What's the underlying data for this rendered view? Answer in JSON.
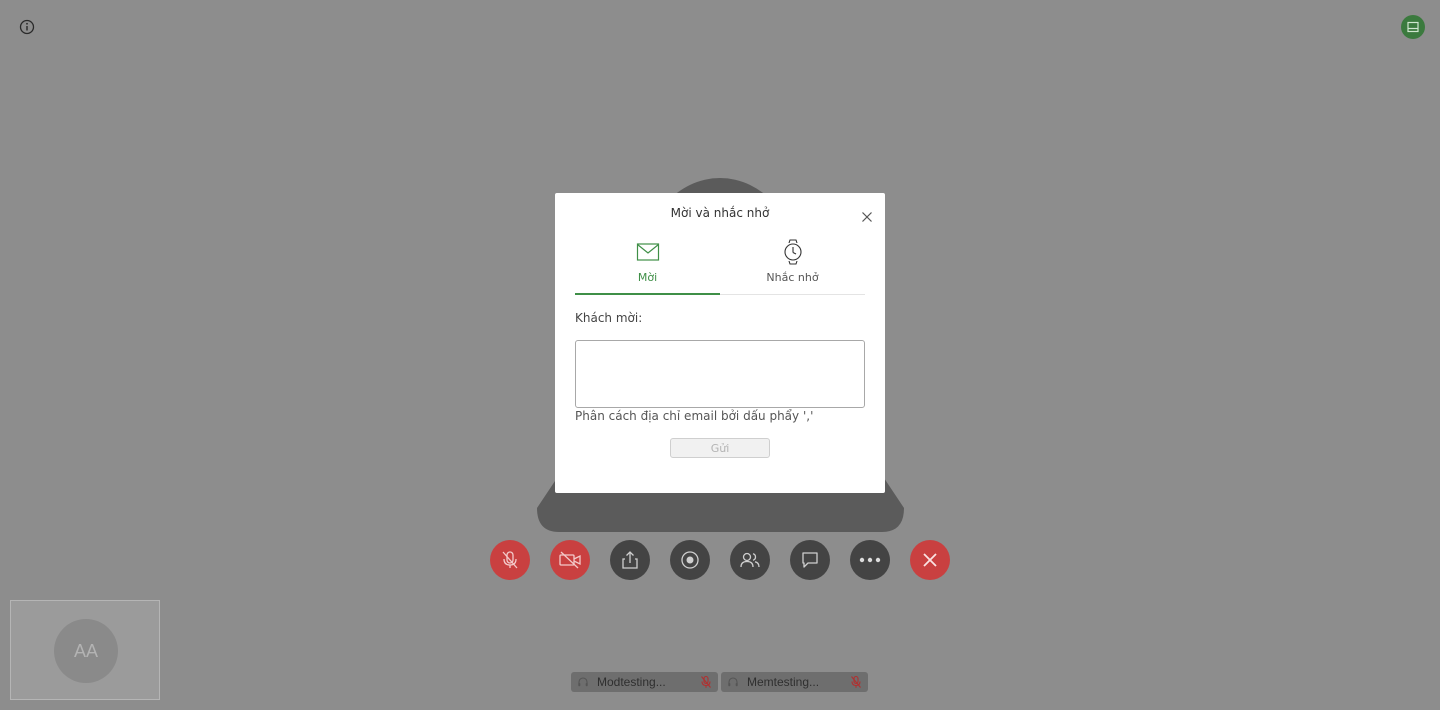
{
  "modal": {
    "title": "Mời và nhắc nhở",
    "tabs": [
      {
        "label": "Mời",
        "icon": "envelope-icon",
        "active": true
      },
      {
        "label": "Nhắc nhở",
        "icon": "watch-icon",
        "active": false
      }
    ],
    "guests_label": "Khách mời:",
    "guests_value": "",
    "hint": "Phân cách địa chỉ email bởi dấu phẩy ','",
    "send_label": "Gửi"
  },
  "self_view": {
    "initials": "AA"
  },
  "participants": [
    {
      "name": "Modtesting...",
      "muted": true
    },
    {
      "name": "Memtesting...",
      "muted": true
    }
  ],
  "toolbar": {
    "buttons": [
      {
        "name": "mic-muted-icon",
        "color": "#c94040"
      },
      {
        "name": "camera-off-icon",
        "color": "#c94040"
      },
      {
        "name": "share-screen-icon",
        "color": "#444444"
      },
      {
        "name": "record-icon",
        "color": "#444444"
      },
      {
        "name": "participants-icon",
        "color": "#444444"
      },
      {
        "name": "chat-icon",
        "color": "#444444"
      },
      {
        "name": "more-icon",
        "color": "#444444"
      },
      {
        "name": "end-call-icon",
        "color": "#c94040"
      }
    ]
  },
  "colors": {
    "accent": "#3f8f47",
    "danger": "#c94040",
    "backdrop": "#8d8d8d"
  }
}
